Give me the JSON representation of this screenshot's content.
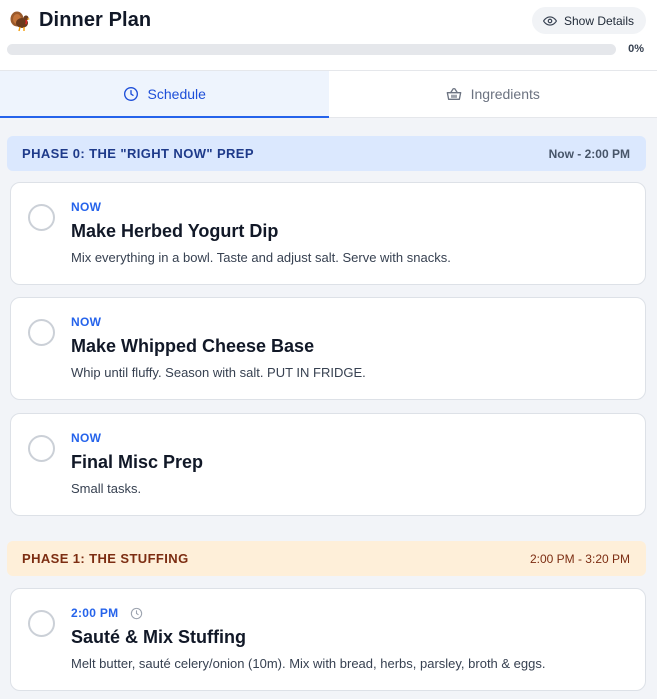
{
  "header": {
    "title": "Dinner Plan",
    "details_label": "Show Details",
    "progress_percent": 0,
    "progress_label": "0%"
  },
  "tabs": [
    {
      "label": "Schedule",
      "icon": "clock-icon",
      "active": true
    },
    {
      "label": "Ingredients",
      "icon": "basket-icon",
      "active": false
    }
  ],
  "phases": [
    {
      "title": "PHASE 0: THE \"RIGHT NOW\" PREP",
      "time": "Now - 2:00 PM",
      "tasks": [
        {
          "time": "NOW",
          "title": "Make Herbed Yogurt Dip",
          "desc": "Mix everything in a bowl. Taste and adjust salt. Serve with snacks."
        },
        {
          "time": "NOW",
          "title": "Make Whipped Cheese Base",
          "desc": "Whip until fluffy. Season with salt. PUT IN FRIDGE."
        },
        {
          "time": "NOW",
          "title": "Final Misc Prep",
          "desc": "Small tasks."
        }
      ]
    },
    {
      "title": "PHASE 1: THE STUFFING",
      "time": "2:00 PM - 3:20 PM",
      "tasks": [
        {
          "time": "2:00 PM",
          "title": "Sauté & Mix Stuffing",
          "desc": "Melt butter, sauté celery/onion (10m). Mix with bread, herbs, parsley, broth & eggs."
        }
      ]
    }
  ],
  "colors": {
    "accent": "#2563eb",
    "phase0_bg": "#dbe8fe",
    "phase1_bg": "#feefd9"
  }
}
